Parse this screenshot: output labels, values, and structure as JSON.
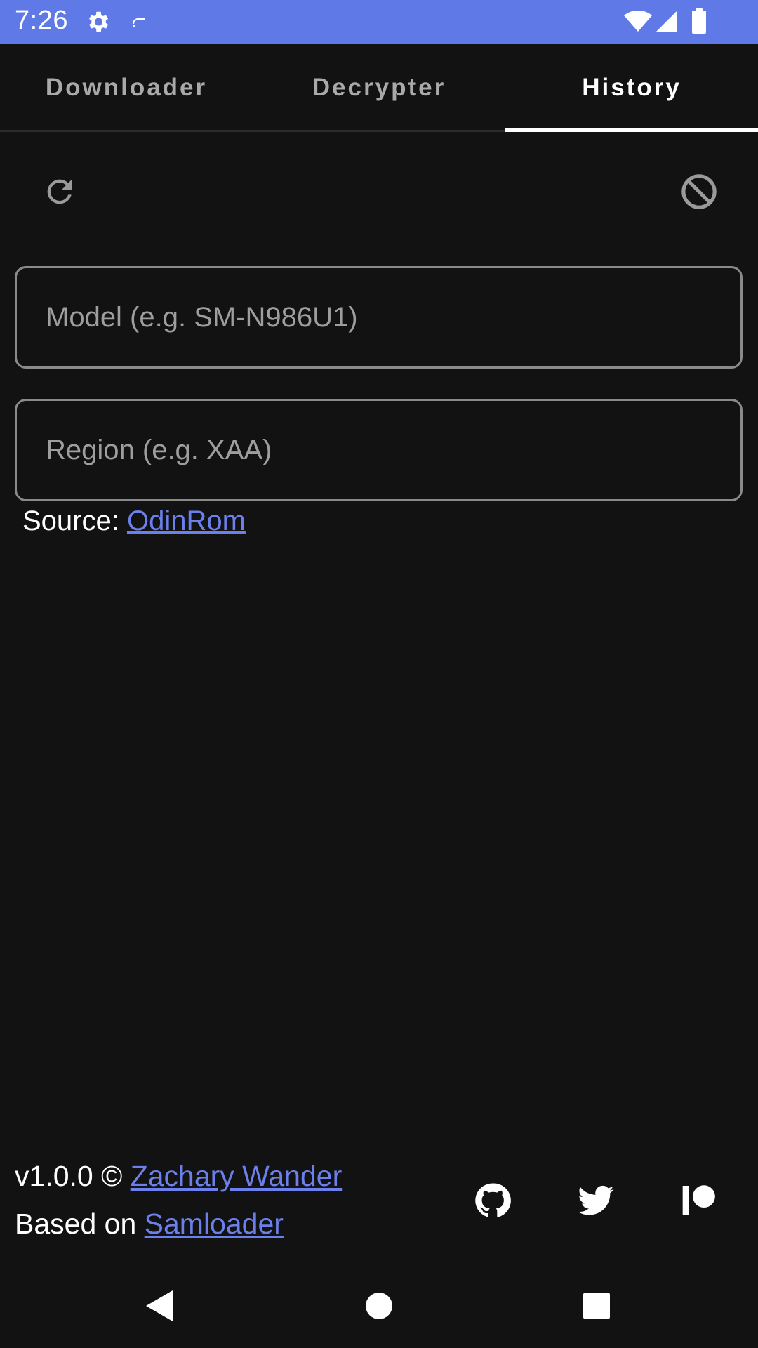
{
  "status_bar": {
    "time": "7:26",
    "background": "#5f7ae6",
    "icons": [
      "gear-icon",
      "cast-icon",
      "wifi-icon",
      "signal-icon",
      "battery-icon"
    ]
  },
  "tabs": [
    {
      "label": "Downloader",
      "active": false
    },
    {
      "label": "Decrypter",
      "active": false
    },
    {
      "label": "History",
      "active": true
    }
  ],
  "toolbar": {
    "refresh_icon": "refresh-icon",
    "clear_icon": "block-icon"
  },
  "form": {
    "model_placeholder": "Model (e.g. SM-N986U1)",
    "model_value": "",
    "region_placeholder": "Region (e.g. XAA)",
    "region_value": ""
  },
  "source": {
    "prefix": "Source: ",
    "link_label": "OdinRom"
  },
  "footer": {
    "version_prefix": "v1.0.0 © ",
    "author_link": "Zachary Wander",
    "based_prefix": "Based on ",
    "based_link": "Samloader",
    "social_icons": [
      "github-icon",
      "twitter-icon",
      "patreon-icon"
    ]
  },
  "colors": {
    "accent": "#6b80ec",
    "background": "#121212",
    "status_bar": "#5f7ae6"
  }
}
